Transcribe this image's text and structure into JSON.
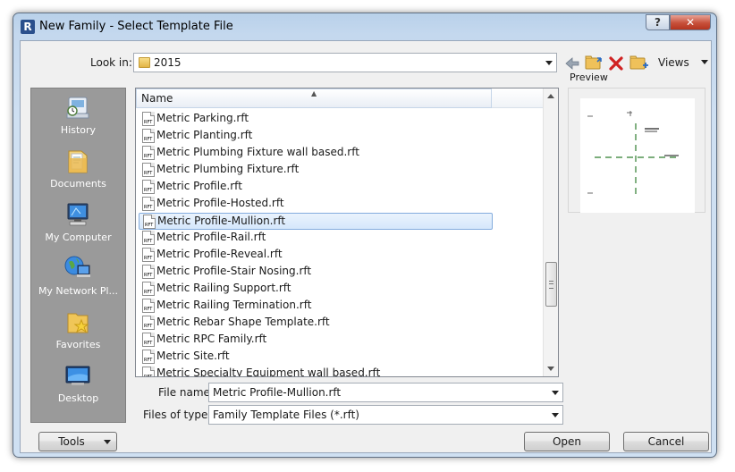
{
  "window": {
    "title": "New Family - Select Template File",
    "help_label": "?",
    "close_label": "✕"
  },
  "toolbar": {
    "look_in_label": "Look in:",
    "look_in_value": "2015",
    "views_label": "Views"
  },
  "places": [
    {
      "label": "History",
      "icon": "history-icon"
    },
    {
      "label": "Documents",
      "icon": "documents-icon"
    },
    {
      "label": "My Computer",
      "icon": "computer-icon"
    },
    {
      "label": "My Network Pl...",
      "icon": "network-icon"
    },
    {
      "label": "Favorites",
      "icon": "favorites-icon"
    },
    {
      "label": "Desktop",
      "icon": "desktop-icon"
    }
  ],
  "file_list": {
    "column_header": "Name",
    "icon_text": "RFT",
    "files": [
      "Metric Parking.rft",
      "Metric Planting.rft",
      "Metric Plumbing Fixture wall based.rft",
      "Metric Plumbing Fixture.rft",
      "Metric Profile.rft",
      "Metric Profile-Hosted.rft",
      "Metric Profile-Mullion.rft",
      "Metric Profile-Rail.rft",
      "Metric Profile-Reveal.rft",
      "Metric Profile-Stair Nosing.rft",
      "Metric Railing Support.rft",
      "Metric Railing Termination.rft",
      "Metric Rebar Shape Template.rft",
      "Metric RPC Family.rft",
      "Metric Site.rft",
      "Metric Specialty Equipment wall based.rft"
    ],
    "selected": "Metric Profile-Mullion.rft"
  },
  "preview": {
    "label": "Preview"
  },
  "file_name": {
    "label": "File name:",
    "value": "Metric Profile-Mullion.rft"
  },
  "file_type": {
    "label": "Files of type:",
    "value": "Family Template Files  (*.rft)"
  },
  "buttons": {
    "tools": "Tools",
    "open": "Open",
    "cancel": "Cancel"
  },
  "colors": {
    "selection": "#d5e7fb",
    "places_bg": "#9a9a9a",
    "titlebar": "#b9d1ea",
    "close": "#c7503b"
  }
}
